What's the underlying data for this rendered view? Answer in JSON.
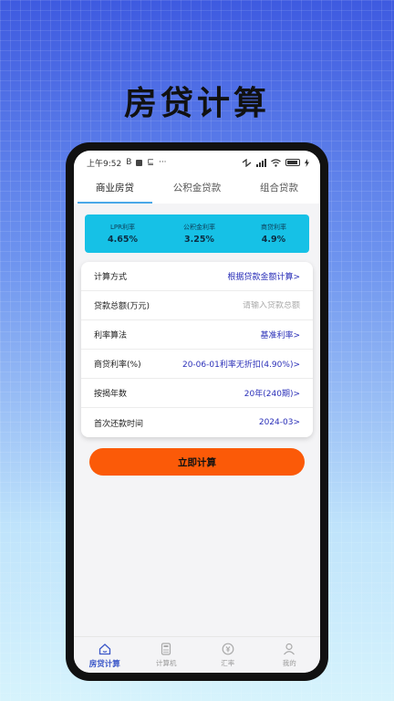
{
  "promo": {
    "title": "房贷计算"
  },
  "status_bar": {
    "time": "上午9:52",
    "extra": "B",
    "dots": "···",
    "n_glyph": "⊑"
  },
  "tabs": [
    {
      "label": "商业房贷",
      "active": true
    },
    {
      "label": "公积金贷款",
      "active": false
    },
    {
      "label": "组合贷款",
      "active": false
    }
  ],
  "rates": [
    {
      "label": "LPR利率",
      "value": "4.65%"
    },
    {
      "label": "公积金利率",
      "value": "3.25%"
    },
    {
      "label": "商贷利率",
      "value": "4.9%"
    }
  ],
  "form": {
    "calc_method": {
      "label": "计算方式",
      "value": "根据贷款金额计算>"
    },
    "loan_amount": {
      "label": "贷款总额(万元)",
      "placeholder": "请输入贷款总额"
    },
    "rate_method": {
      "label": "利率算法",
      "value": "基准利率>"
    },
    "commercial_rate": {
      "label": "商贷利率(%)",
      "value": "20-06-01利率无折扣(4.90%)>"
    },
    "years": {
      "label": "按揭年数",
      "value": "20年(240期)>"
    },
    "first_payment": {
      "label": "首次还款时间",
      "value": "2024-03>"
    }
  },
  "calculate_button": {
    "label": "立即计算"
  },
  "bottom_nav": [
    {
      "label": "房贷计算",
      "icon": "house-icon",
      "active": true
    },
    {
      "label": "计算机",
      "icon": "calculator-icon",
      "active": false
    },
    {
      "label": "汇率",
      "icon": "exchange-icon",
      "active": false
    },
    {
      "label": "我的",
      "icon": "profile-icon",
      "active": false
    }
  ],
  "colors": {
    "accent": "#16c1e6",
    "button": "#fb5a08",
    "value_text": "#2a2fb8",
    "tab_indicator": "#4aa8e8"
  }
}
